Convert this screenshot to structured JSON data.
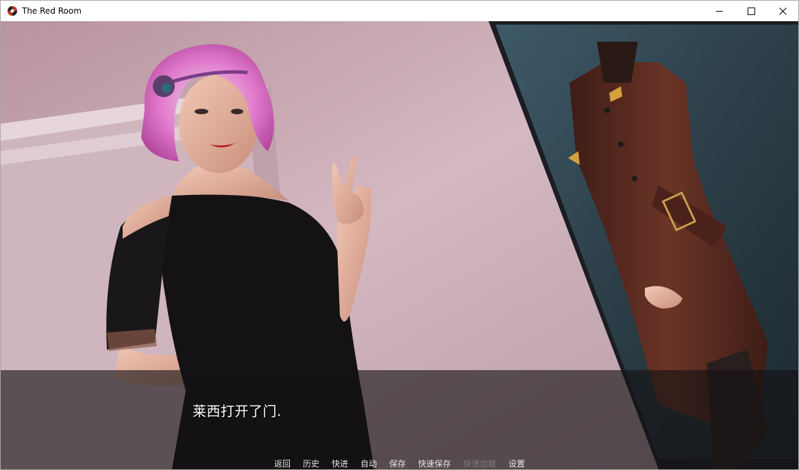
{
  "window": {
    "title": "The Red Room",
    "minimize_icon": "minimize-icon",
    "maximize_icon": "maximize-icon",
    "close_icon": "close-icon"
  },
  "dialogue": {
    "text": "莱西打开了门."
  },
  "quick_menu": {
    "items": [
      {
        "label": "返回",
        "enabled": true
      },
      {
        "label": "历史",
        "enabled": true
      },
      {
        "label": "快进",
        "enabled": true
      },
      {
        "label": "自动",
        "enabled": true
      },
      {
        "label": "保存",
        "enabled": true
      },
      {
        "label": "快速保存",
        "enabled": true
      },
      {
        "label": "快速加载",
        "enabled": false
      },
      {
        "label": "设置",
        "enabled": true
      }
    ]
  },
  "colors": {
    "wall": "#c9a9b3",
    "dress": "#141214",
    "hair": "#d86ac0",
    "uniform": "#5a2c22",
    "dialogue_bg": "#141214"
  }
}
